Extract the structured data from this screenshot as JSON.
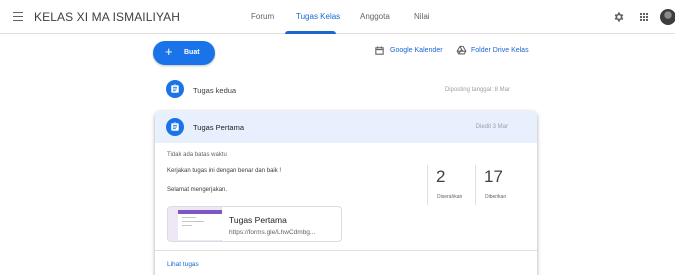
{
  "header": {
    "class_title": "KELAS XI MA ISMAILIYAH",
    "tabs": [
      {
        "label": "Forum"
      },
      {
        "label": "Tugas Kelas"
      },
      {
        "label": "Anggota"
      },
      {
        "label": "Nilai"
      }
    ],
    "active_tab": "Tugas Kelas",
    "icons": [
      "menu-icon",
      "settings-icon",
      "apps-grid-icon"
    ]
  },
  "toolbar": {
    "create_label": "Buat",
    "calendar_label": "Google Kalender",
    "drive_label": "Folder Drive Kelas"
  },
  "assignments": [
    {
      "title": "Tugas kedua",
      "date": "Diposting tanggal: 8 Mar"
    },
    {
      "title": "Tugas Pertama",
      "date": "Diedit 3 Mar",
      "due": "Tidak ada batas waktu",
      "description": [
        "Kerjakan tugas ini dengan benar dan baik !",
        "Selamat mengerjakan."
      ],
      "stats": [
        {
          "value": "2",
          "label": "Diserahkan"
        },
        {
          "value": "17",
          "label": "Diberikan"
        }
      ],
      "attachment": {
        "title": "Tugas Pertama",
        "url": "https://forms.gle/LhwCdmbg..."
      },
      "view_label": "Lihat tugas"
    }
  ],
  "colors": {
    "accent": "#1a73e8",
    "link": "#1967d2",
    "card_header": "#e8f0fe"
  }
}
